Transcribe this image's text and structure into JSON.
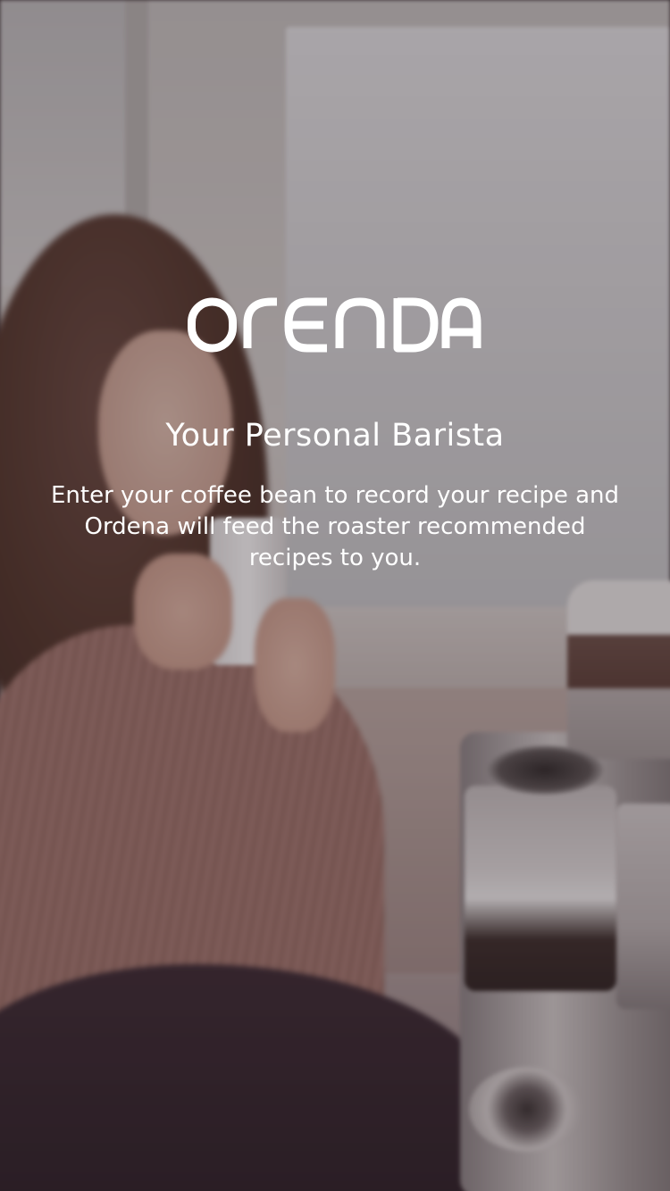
{
  "app": {
    "logo_text": "ORENDA",
    "tagline": "Your Personal Barista",
    "description": "Enter your coffee bean to record your recipe and Ordena will feed the roaster recommended recipes to you."
  },
  "colors": {
    "text": "#ffffff",
    "overlay": "#281c22"
  },
  "icons": {
    "logo": "orenda-wordmark-icon",
    "background": "coffee-photo-background"
  }
}
